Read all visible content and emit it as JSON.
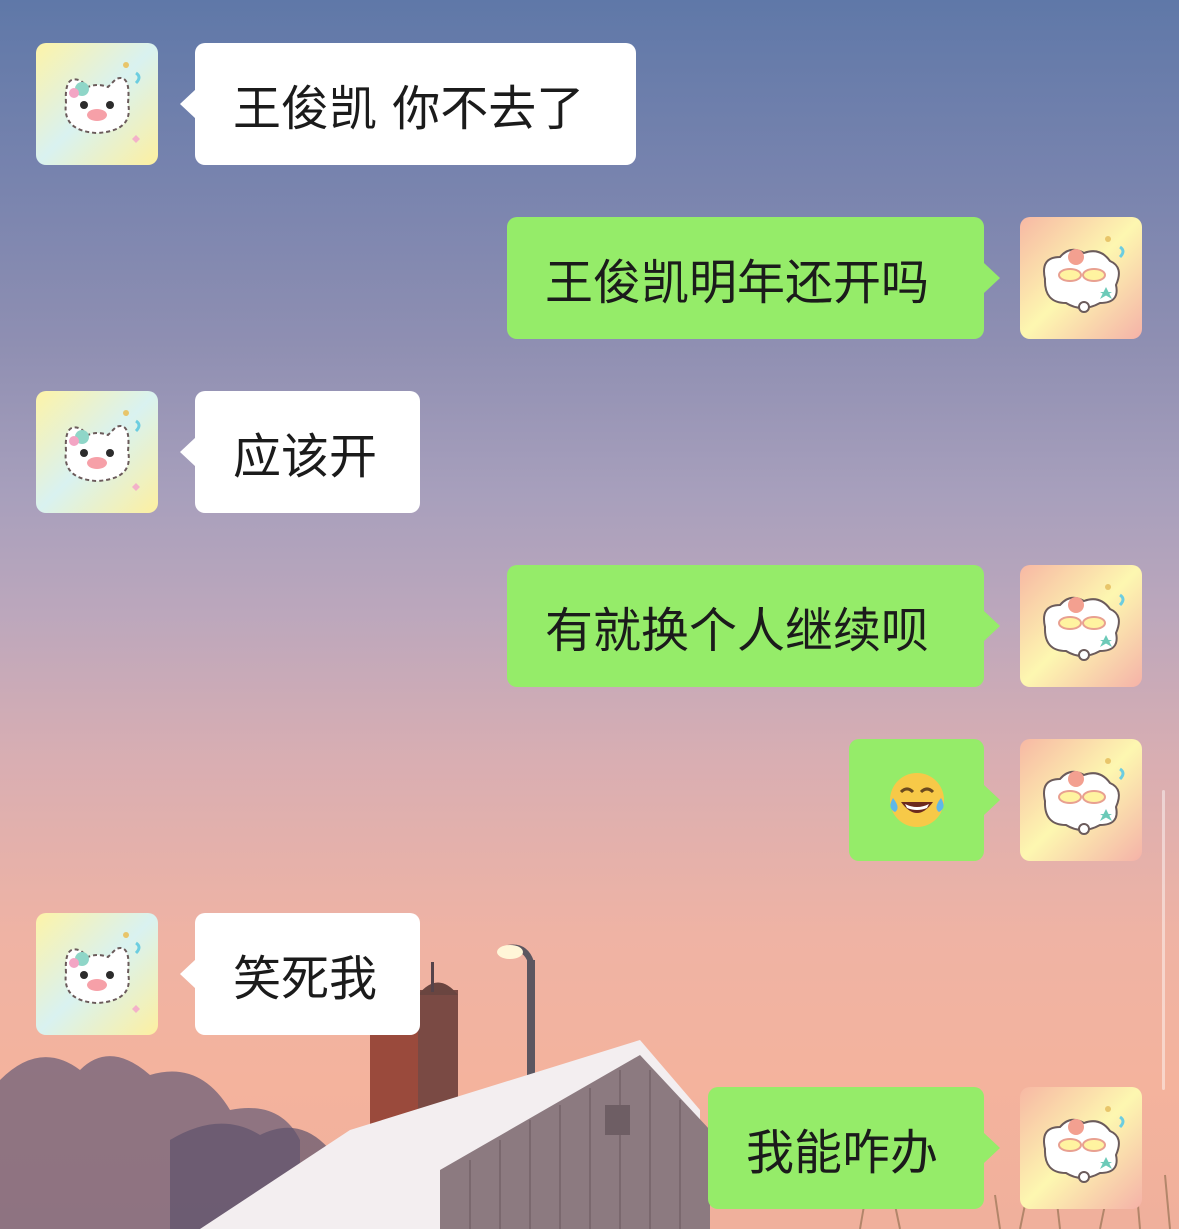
{
  "colors": {
    "incoming_bubble": "#ffffff",
    "outgoing_bubble": "#95ec69",
    "text": "#1b1b1b"
  },
  "background": {
    "description_icon": "sunset-house-wallpaper"
  },
  "avatars": {
    "contact": "cat-avatar-icon",
    "self": "sheep-avatar-icon"
  },
  "messages": [
    {
      "side": "in",
      "text": "王俊凯 你不去了"
    },
    {
      "side": "out",
      "text": "王俊凯明年还开吗"
    },
    {
      "side": "in",
      "text": "应该开"
    },
    {
      "side": "out",
      "text": "有就换个人继续呗"
    },
    {
      "side": "out",
      "text": "",
      "emoji": "tears-of-joy-emoji-icon"
    },
    {
      "side": "in",
      "text": "笑死我"
    },
    {
      "side": "out",
      "text": "我能咋办"
    }
  ]
}
